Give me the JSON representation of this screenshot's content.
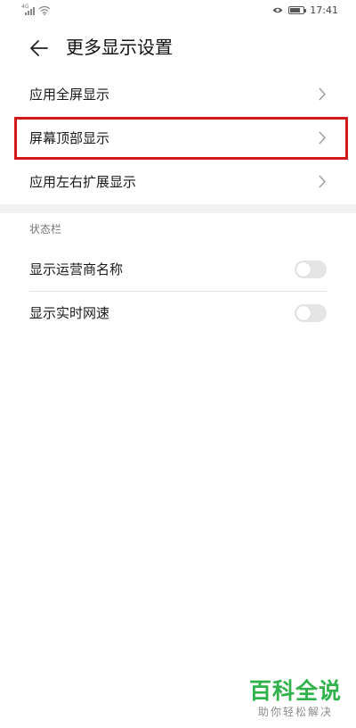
{
  "status_bar": {
    "network": "4G",
    "time": "17:41",
    "battery_level": 0.8
  },
  "header": {
    "back_icon": "back-arrow-icon",
    "title": "更多显示设置"
  },
  "items": [
    {
      "label": "应用全屏显示",
      "icon": "chevron-right-icon"
    },
    {
      "label": "屏幕顶部显示",
      "icon": "chevron-right-icon"
    },
    {
      "label": "应用左右扩展显示",
      "icon": "chevron-right-icon"
    }
  ],
  "status_section": {
    "title": "状态栏",
    "toggles": [
      {
        "label": "显示运营商名称",
        "on": false
      },
      {
        "label": "显示实时网速",
        "on": false
      }
    ]
  },
  "highlight_color": "#d21a1a",
  "watermark": {
    "main": "百科全说",
    "sub": "助你轻松解决",
    "color": "#2fb24a"
  }
}
